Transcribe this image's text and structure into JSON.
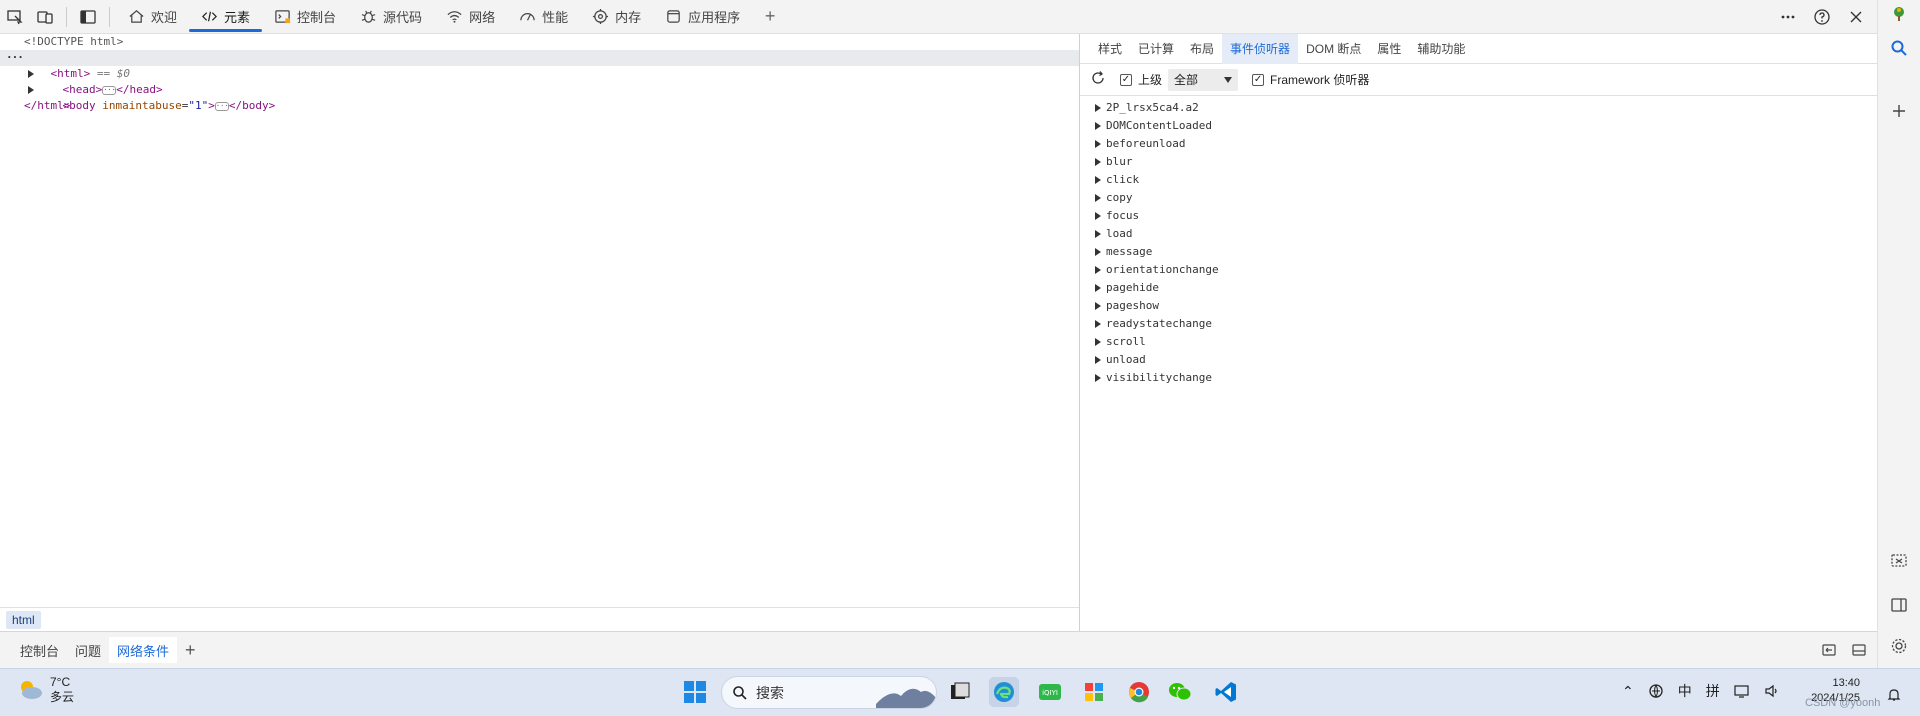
{
  "toolbar": {
    "tabs": [
      {
        "label": "欢迎",
        "icon": "home-icon"
      },
      {
        "label": "元素",
        "icon": "code-icon"
      },
      {
        "label": "控制台",
        "icon": "console-icon"
      },
      {
        "label": "源代码",
        "icon": "bug-icon"
      },
      {
        "label": "网络",
        "icon": "wifi-icon"
      },
      {
        "label": "性能",
        "icon": "gauge-icon"
      },
      {
        "label": "内存",
        "icon": "memory-icon"
      },
      {
        "label": "应用程序",
        "icon": "app-window-icon"
      }
    ],
    "active_tab": "元素"
  },
  "dom": {
    "doctype": "<!DOCTYPE html>",
    "html_open": "<html>",
    "selected_marker": "== $0",
    "head_open": "<head>",
    "head_close": "</head>",
    "body_open_tag": "<body",
    "body_attr_name": "inmaintabuse",
    "body_attr_value": "\"1\"",
    "body_close": "</body>",
    "html_close": "</html>"
  },
  "breadcrumb": {
    "item": "html"
  },
  "side_panel": {
    "tabs": [
      "样式",
      "已计算",
      "布局",
      "事件侦听器",
      "DOM 断点",
      "属性",
      "辅助功能"
    ],
    "active_tab": "事件侦听器",
    "filter": {
      "ancestors_label": "上级",
      "ancestors_checked": true,
      "select_value": "全部",
      "framework_label": "Framework 侦听器",
      "framework_checked": true
    },
    "events": [
      "2P_lrsx5ca4.a2",
      "DOMContentLoaded",
      "beforeunload",
      "blur",
      "click",
      "copy",
      "focus",
      "load",
      "message",
      "orientationchange",
      "pagehide",
      "pageshow",
      "readystatechange",
      "scroll",
      "unload",
      "visibilitychange"
    ]
  },
  "drawer": {
    "tabs": [
      "控制台",
      "问题",
      "网络条件"
    ],
    "active_tab": "网络条件"
  },
  "taskbar": {
    "weather_temp": "7°C",
    "weather_desc": "多云",
    "search_label": "搜索",
    "ime_lang": "中",
    "ime_mode": "拼",
    "time": "13:40",
    "date": "2024/1/25",
    "watermark": "CSDN @yoonh"
  },
  "colors": {
    "accent": "#1c6ad8",
    "tag": "#881280",
    "attr_name": "#994500",
    "attr_value": "#1a1aa6",
    "taskbar": "#dde6f2"
  }
}
